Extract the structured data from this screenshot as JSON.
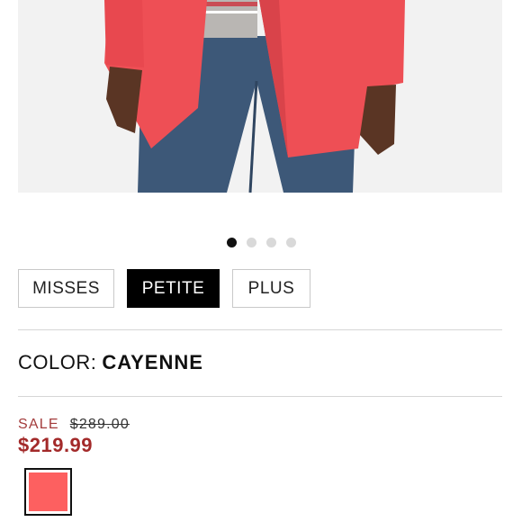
{
  "product": {
    "image_alt": "Model wearing coat with jeans",
    "carousel": {
      "total": 4,
      "active": 0
    },
    "sizes": [
      {
        "label": "MISSES",
        "selected": false
      },
      {
        "label": "PETITE",
        "selected": true
      },
      {
        "label": "PLUS",
        "selected": false
      }
    ],
    "color": {
      "label": "COLOR:",
      "value": "CAYENNE",
      "hex": "#fd6060"
    },
    "pricing": {
      "sale_label": "SALE",
      "original_price": "$289.00",
      "sale_price": "$219.99",
      "sale_color": "#a32a2a"
    }
  },
  "colors": {
    "coat": "#ee4f55",
    "coat_shadow": "#d9434a",
    "jeans": "#3d5878",
    "sweater": "#b9b6b3",
    "skin": "#5a3524",
    "background": "#f1f1f1"
  }
}
